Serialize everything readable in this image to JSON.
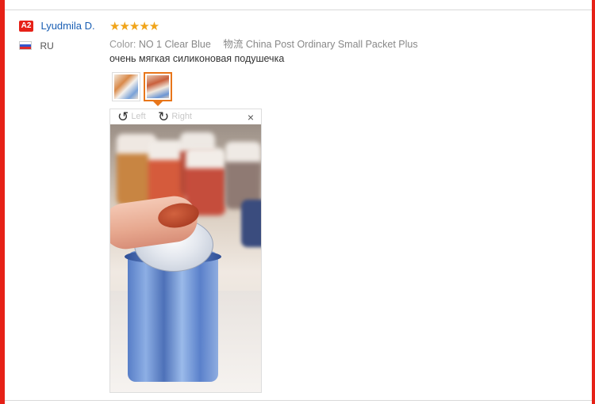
{
  "review": {
    "user_badge": "A2",
    "user_name": "Lyudmila D.",
    "country_code": "RU",
    "stars": "★★★★★",
    "color_label": "Color:",
    "color_value": "NO 1 Clear Blue",
    "shipping_icon_text": "物流",
    "shipping_value": "China Post Ordinary Small Packet Plus",
    "comment": "очень мягкая силиконовая подушечка"
  },
  "viewer": {
    "rotate_left_label": "Left",
    "rotate_right_label": "Right",
    "rotate_left_icon": "↺",
    "rotate_right_icon": "↻",
    "close_icon": "×"
  },
  "colors": {
    "frame": "#e62117",
    "stars": "#f0a41a",
    "username": "#1a5fb4",
    "selected_thumb": "#e8761a"
  }
}
